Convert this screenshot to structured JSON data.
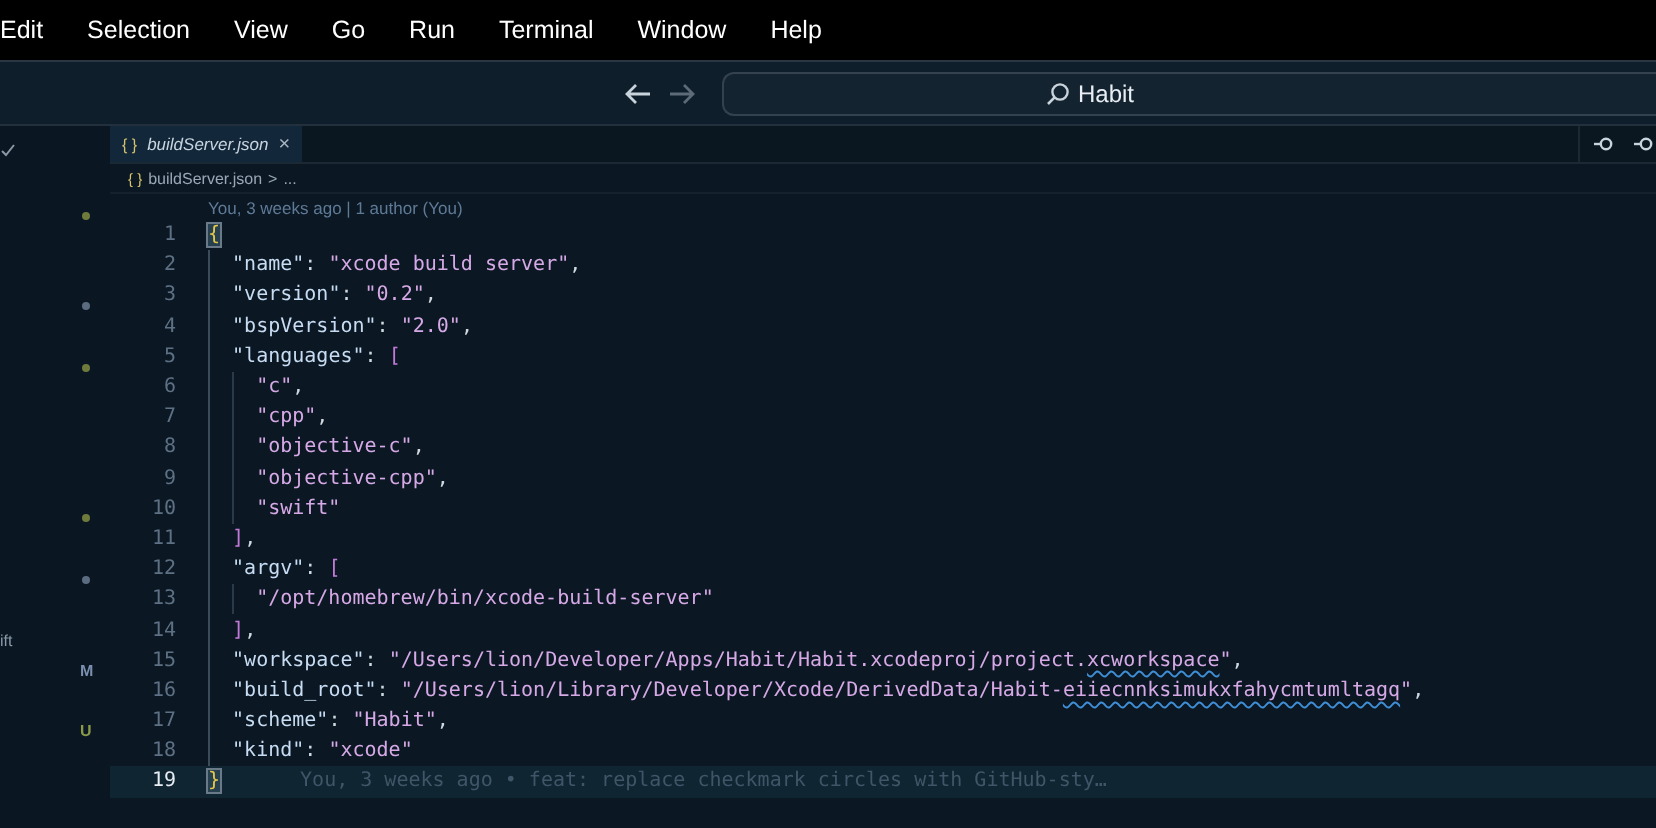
{
  "menu_bar": [
    "Edit",
    "Selection",
    "View",
    "Go",
    "Run",
    "Terminal",
    "Window",
    "Help"
  ],
  "title_bar": {
    "search": {
      "value": "Habit"
    }
  },
  "sidebar": {
    "rows": [
      {
        "kind": "dot",
        "color": "#6e7b3c"
      },
      {
        "kind": "blank"
      },
      {
        "kind": "blank"
      },
      {
        "kind": "dot",
        "color": "#5c6c80"
      },
      {
        "kind": "blank"
      },
      {
        "kind": "dot",
        "color": "#6e7b3c"
      },
      {
        "kind": "blank"
      },
      {
        "kind": "blank"
      },
      {
        "kind": "blank"
      },
      {
        "kind": "blank"
      },
      {
        "kind": "dot",
        "color": "#6e7b3c"
      },
      {
        "kind": "blank"
      },
      {
        "kind": "dot",
        "color": "#5c6c80"
      },
      {
        "kind": "blank"
      },
      {
        "kind": "label",
        "text": "ift"
      },
      {
        "kind": "badge",
        "text": "M",
        "color": "#7b8fb0"
      },
      {
        "kind": "blank"
      },
      {
        "kind": "badge",
        "text": "U",
        "color": "#8a9a4a"
      }
    ]
  },
  "tabs": [
    {
      "icon_text": "{ }",
      "label": "buildServer.json",
      "close": "×",
      "selected": true
    }
  ],
  "breadcrumb": {
    "icon_text": "{ }",
    "file": "buildServer.json",
    "separator": ">",
    "rest": "..."
  },
  "blame_header": "You, 3 weeks ago | 1 author (You)",
  "editor": {
    "lines": [
      {
        "number": "1",
        "current": false,
        "tokens": [
          {
            "text": "{",
            "kind": "brace_match"
          }
        ]
      },
      {
        "number": "2",
        "current": false,
        "tokens": [
          {
            "text": "  \"name\"",
            "kind": "key"
          },
          {
            "text": ": ",
            "kind": "punct"
          },
          {
            "text": "\"xcode build server\"",
            "kind": "string"
          },
          {
            "text": ",",
            "kind": "punct"
          }
        ]
      },
      {
        "number": "3",
        "current": false,
        "tokens": [
          {
            "text": "  \"version\"",
            "kind": "key"
          },
          {
            "text": ": ",
            "kind": "punct"
          },
          {
            "text": "\"0.2\"",
            "kind": "string"
          },
          {
            "text": ",",
            "kind": "punct"
          }
        ]
      },
      {
        "number": "4",
        "current": false,
        "tokens": [
          {
            "text": "  \"bspVersion\"",
            "kind": "key"
          },
          {
            "text": ": ",
            "kind": "punct"
          },
          {
            "text": "\"2.0\"",
            "kind": "string"
          },
          {
            "text": ",",
            "kind": "punct"
          }
        ]
      },
      {
        "number": "5",
        "current": false,
        "tokens": [
          {
            "text": "  \"languages\"",
            "kind": "key"
          },
          {
            "text": ": ",
            "kind": "punct"
          },
          {
            "text": "[",
            "kind": "bracket"
          }
        ]
      },
      {
        "number": "6",
        "current": false,
        "tokens": [
          {
            "text": "    \"c\"",
            "kind": "string"
          },
          {
            "text": ",",
            "kind": "punct"
          }
        ]
      },
      {
        "number": "7",
        "current": false,
        "tokens": [
          {
            "text": "    \"cpp\"",
            "kind": "string"
          },
          {
            "text": ",",
            "kind": "punct"
          }
        ]
      },
      {
        "number": "8",
        "current": false,
        "tokens": [
          {
            "text": "    \"objective-c\"",
            "kind": "string"
          },
          {
            "text": ",",
            "kind": "punct"
          }
        ]
      },
      {
        "number": "9",
        "current": false,
        "tokens": [
          {
            "text": "    \"objective-cpp\"",
            "kind": "string"
          },
          {
            "text": ",",
            "kind": "punct"
          }
        ]
      },
      {
        "number": "10",
        "current": false,
        "tokens": [
          {
            "text": "    \"swift\"",
            "kind": "string"
          }
        ]
      },
      {
        "number": "11",
        "current": false,
        "tokens": [
          {
            "text": "  ]",
            "kind": "bracket"
          },
          {
            "text": ",",
            "kind": "punct"
          }
        ]
      },
      {
        "number": "12",
        "current": false,
        "tokens": [
          {
            "text": "  \"argv\"",
            "kind": "key"
          },
          {
            "text": ": ",
            "kind": "punct"
          },
          {
            "text": "[",
            "kind": "bracket"
          }
        ]
      },
      {
        "number": "13",
        "current": false,
        "tokens": [
          {
            "text": "    \"/opt/homebrew/bin/xcode-build-server\"",
            "kind": "string"
          }
        ]
      },
      {
        "number": "14",
        "current": false,
        "tokens": [
          {
            "text": "  ]",
            "kind": "bracket"
          },
          {
            "text": ",",
            "kind": "punct"
          }
        ]
      },
      {
        "number": "15",
        "current": false,
        "tokens": [
          {
            "text": "  \"workspace\"",
            "kind": "key"
          },
          {
            "text": ": ",
            "kind": "punct"
          },
          {
            "text": "\"/Users/lion/Developer/Apps/Habit/Habit.xcodeproj/project.",
            "kind": "string"
          },
          {
            "text": "xcworkspace",
            "kind": "misspelled"
          },
          {
            "text": "\"",
            "kind": "string"
          },
          {
            "text": ",",
            "kind": "punct"
          }
        ]
      },
      {
        "number": "16",
        "current": false,
        "tokens": [
          {
            "text": "  \"build_root\"",
            "kind": "key"
          },
          {
            "text": ": ",
            "kind": "punct"
          },
          {
            "text": "\"/Users/lion/Library/Developer/Xcode/DerivedData/Habit-",
            "kind": "string"
          },
          {
            "text": "eiiecnnksimukxfahycmtumltagq",
            "kind": "misspelled"
          },
          {
            "text": "\"",
            "kind": "string"
          },
          {
            "text": ",",
            "kind": "punct"
          }
        ]
      },
      {
        "number": "17",
        "current": false,
        "tokens": [
          {
            "text": "  \"scheme\"",
            "kind": "key"
          },
          {
            "text": ": ",
            "kind": "punct"
          },
          {
            "text": "\"Habit\"",
            "kind": "string"
          },
          {
            "text": ",",
            "kind": "punct"
          }
        ]
      },
      {
        "number": "18",
        "current": false,
        "tokens": [
          {
            "text": "  \"kind\"",
            "kind": "key"
          },
          {
            "text": ": ",
            "kind": "punct"
          },
          {
            "text": "\"xcode\"",
            "kind": "string"
          }
        ]
      },
      {
        "number": "19",
        "current": true,
        "tokens": [
          {
            "text": "}",
            "kind": "brace_match"
          }
        ],
        "blame": "You, 3 weeks ago • feat: replace checkmark circles with GitHub-sty…"
      }
    ]
  }
}
